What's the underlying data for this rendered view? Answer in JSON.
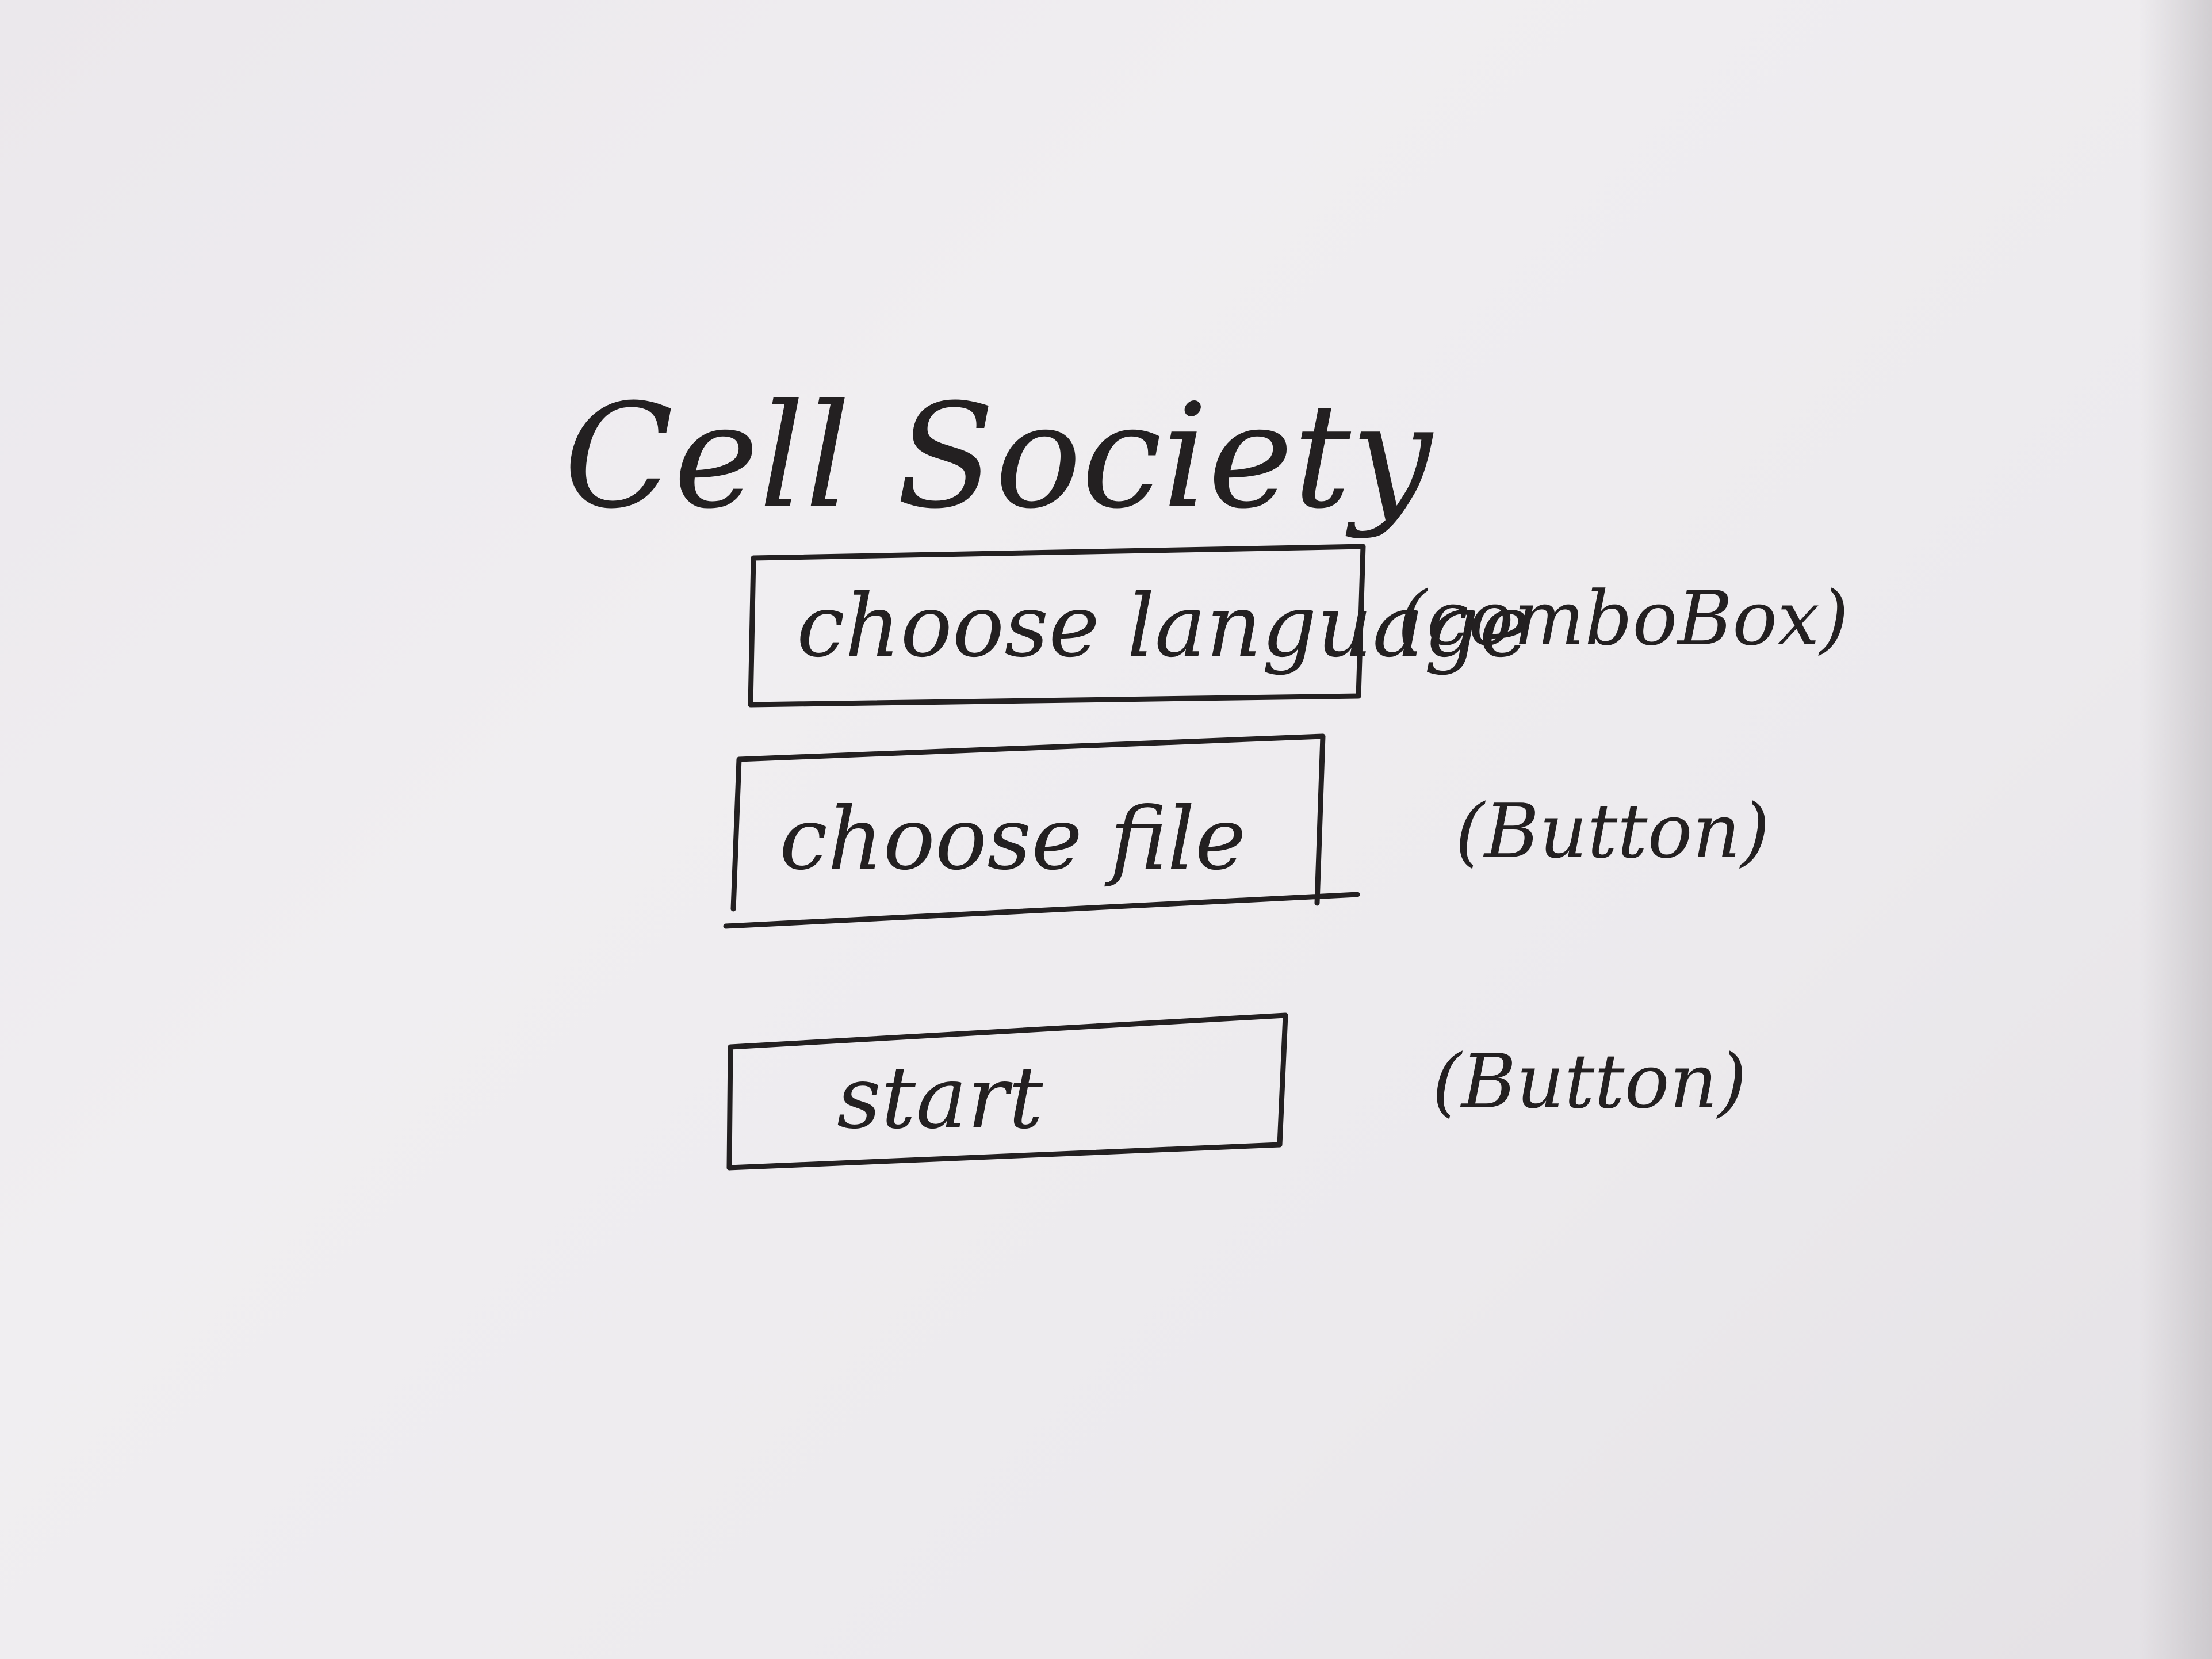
{
  "title": "Cell Society",
  "controls": [
    {
      "label": "choose language",
      "annotation": "(comboBox)"
    },
    {
      "label": "choose file",
      "annotation": "(Button)"
    },
    {
      "label": "start",
      "annotation": "(Button)"
    }
  ],
  "colors": {
    "ink": "#232021",
    "paper": "#ece9ed"
  }
}
